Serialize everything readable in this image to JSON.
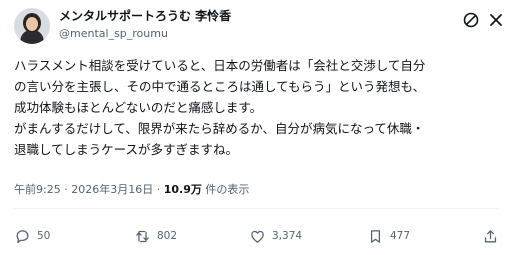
{
  "author": {
    "name": "メンタルサポートろうむ 李怜香",
    "handle": "@mental_sp_roumu"
  },
  "post": {
    "lines": [
      "ハラスメント相談を受けていると、日本の労働者は「会社と交渉して自分",
      "の言い分を主張し、その中で通るところは通してもらう」という発想も、",
      "成功体験もほとんどないのだと痛感します。",
      "がまんするだけして、限界が来たら辞めるか、自分が病気になって休職・",
      "退職してしまうケースが多すぎますね。"
    ]
  },
  "meta": {
    "time": "午前9:25",
    "separator": "·",
    "date": "2026年3月16日",
    "views_count": "10.9万",
    "views_suffix": "件の表示"
  },
  "stats": {
    "replies": "50",
    "reposts": "802",
    "likes": "3,374",
    "bookmarks": "477"
  },
  "icons": {
    "top_right": [
      "no-entry-sign-icon",
      "x-close-icon"
    ],
    "actions": [
      "reply-icon",
      "repost-icon",
      "like-icon",
      "bookmark-icon",
      "share-icon"
    ]
  },
  "colors": {
    "text": "#0f1419",
    "secondary": "#536471",
    "background": "#ffffff"
  }
}
